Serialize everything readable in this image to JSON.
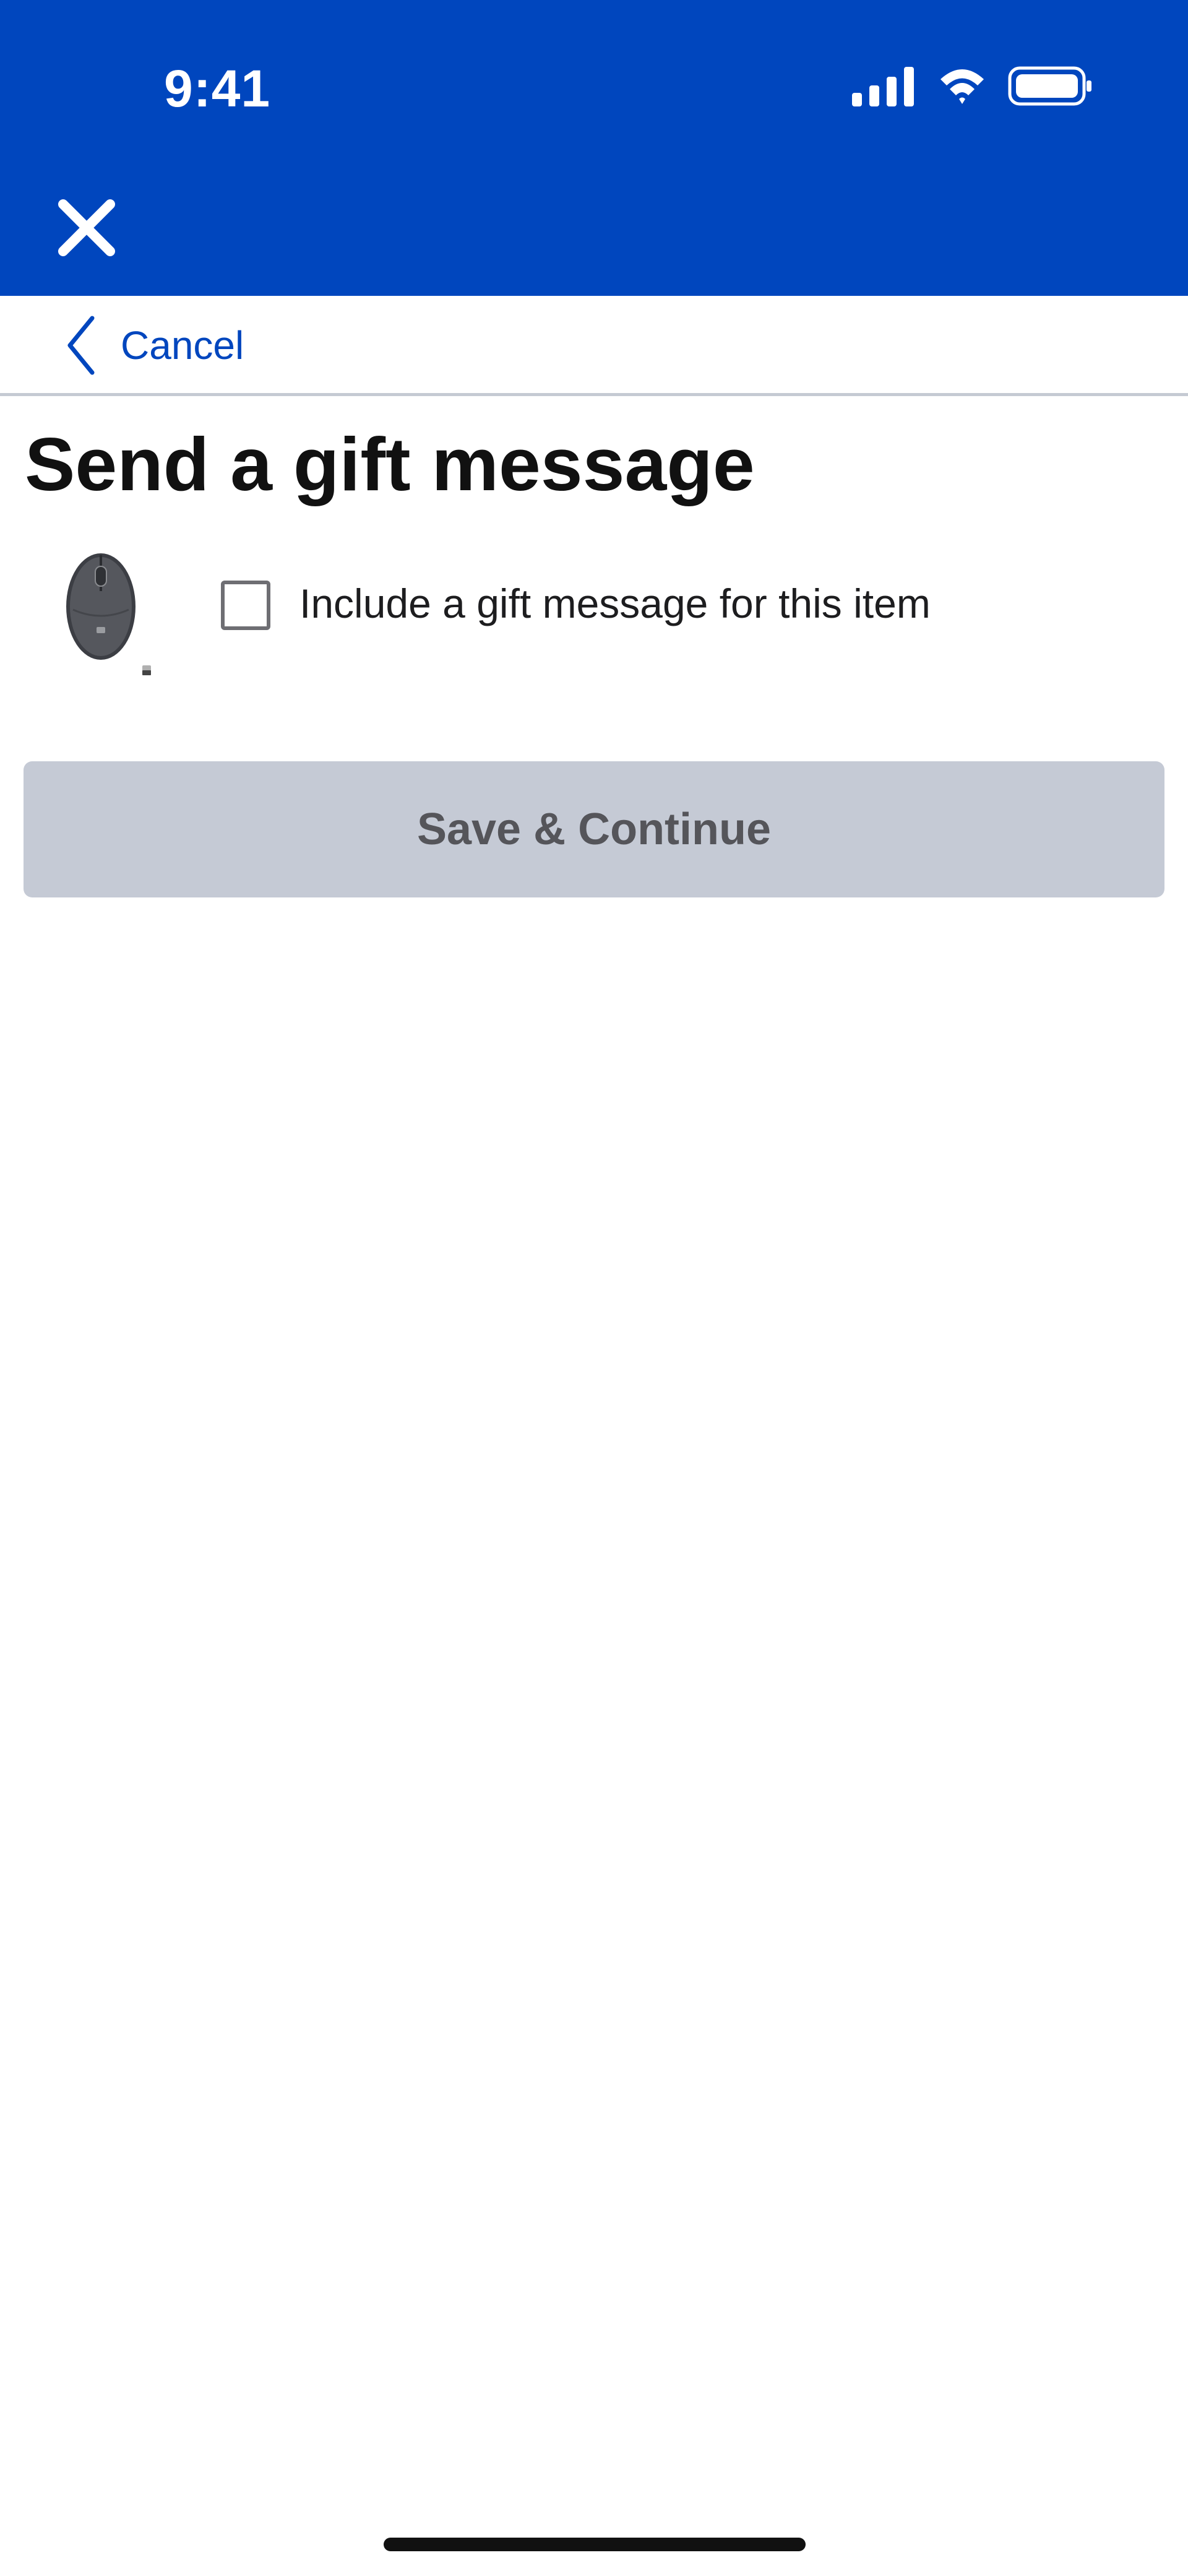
{
  "status_bar": {
    "time": "9:41",
    "icons": [
      "cellular-signal-icon",
      "wifi-icon",
      "battery-icon"
    ]
  },
  "header": {
    "close_icon": "close-icon"
  },
  "nav": {
    "back_icon": "chevron-left-icon",
    "cancel_label": "Cancel"
  },
  "main": {
    "title": "Send a gift message",
    "item": {
      "image_icon": "computer-mouse-icon",
      "checkbox_label": "Include a gift message for this item",
      "checked": false
    },
    "save_label": "Save & Continue"
  },
  "colors": {
    "brand_blue": "#0046be",
    "disabled_button": "#c5cad5",
    "disabled_text": "#55555a"
  }
}
